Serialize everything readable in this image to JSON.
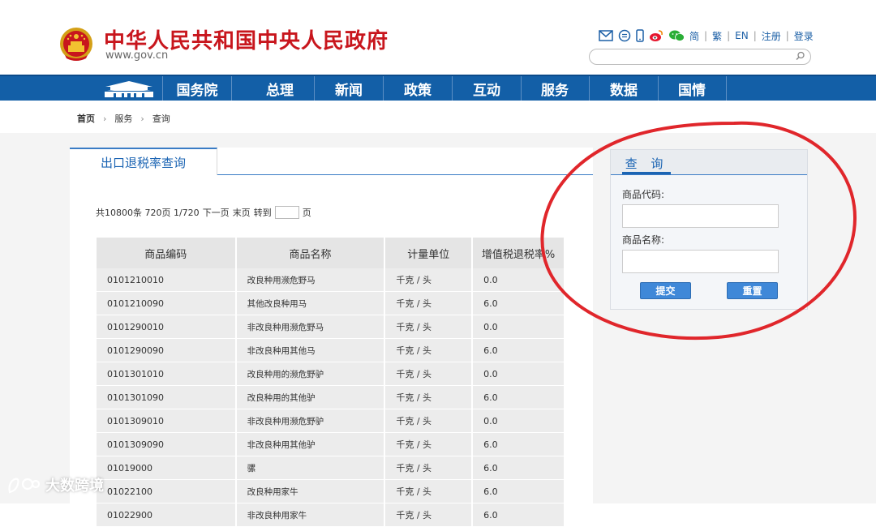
{
  "header": {
    "site_title": "中华人民共和国中央人民政府",
    "site_url": "www.gov.cn",
    "lang": {
      "simplified": "简",
      "traditional": "繁",
      "english": "EN",
      "register": "注册",
      "login": "登录"
    },
    "search_placeholder": ""
  },
  "nav": {
    "items": [
      "国务院",
      "总理",
      "新闻",
      "政策",
      "互动",
      "服务",
      "数据",
      "国情"
    ]
  },
  "breadcrumb": {
    "home": "首页",
    "service": "服务",
    "query": "查询"
  },
  "main": {
    "tab_label": "出口退税率查询",
    "pager": {
      "summary": "共10800条 720页 1/720",
      "next": "下一页",
      "last": "末页",
      "goto": "转到",
      "page_unit": "页",
      "page_input": ""
    },
    "columns": [
      "商品编码",
      "商品名称",
      "计量单位",
      "增值税退税率%"
    ],
    "rows": [
      [
        "0101210010",
        "改良种用濒危野马",
        "千克 / 头",
        "0.0"
      ],
      [
        "0101210090",
        "其他改良种用马",
        "千克 / 头",
        "6.0"
      ],
      [
        "0101290010",
        "非改良种用濒危野马",
        "千克 / 头",
        "0.0"
      ],
      [
        "0101290090",
        "非改良种用其他马",
        "千克 / 头",
        "6.0"
      ],
      [
        "0101301010",
        "改良种用的濒危野驴",
        "千克 / 头",
        "0.0"
      ],
      [
        "0101301090",
        "改良种用的其他驴",
        "千克 / 头",
        "6.0"
      ],
      [
        "0101309010",
        "非改良种用濒危野驴",
        "千克 / 头",
        "0.0"
      ],
      [
        "0101309090",
        "非改良种用其他驴",
        "千克 / 头",
        "6.0"
      ],
      [
        "01019000",
        "骡",
        "千克 / 头",
        "6.0"
      ],
      [
        "01022100",
        "改良种用家牛",
        "千克 / 头",
        "6.0"
      ],
      [
        "01022900",
        "非改良种用家牛",
        "千克 / 头",
        "6.0"
      ]
    ]
  },
  "query": {
    "title": "查 询",
    "code_label": "商品代码:",
    "name_label": "商品名称:",
    "code_value": "",
    "name_value": "",
    "submit": "提交",
    "reset": "重置"
  },
  "watermark": "大数跨境",
  "colors": {
    "brand_red": "#c8161d",
    "nav_blue": "#135fa7",
    "link_blue": "#1b64b3",
    "button_blue": "#3f88d8",
    "annotation_red": "#e0262b"
  }
}
